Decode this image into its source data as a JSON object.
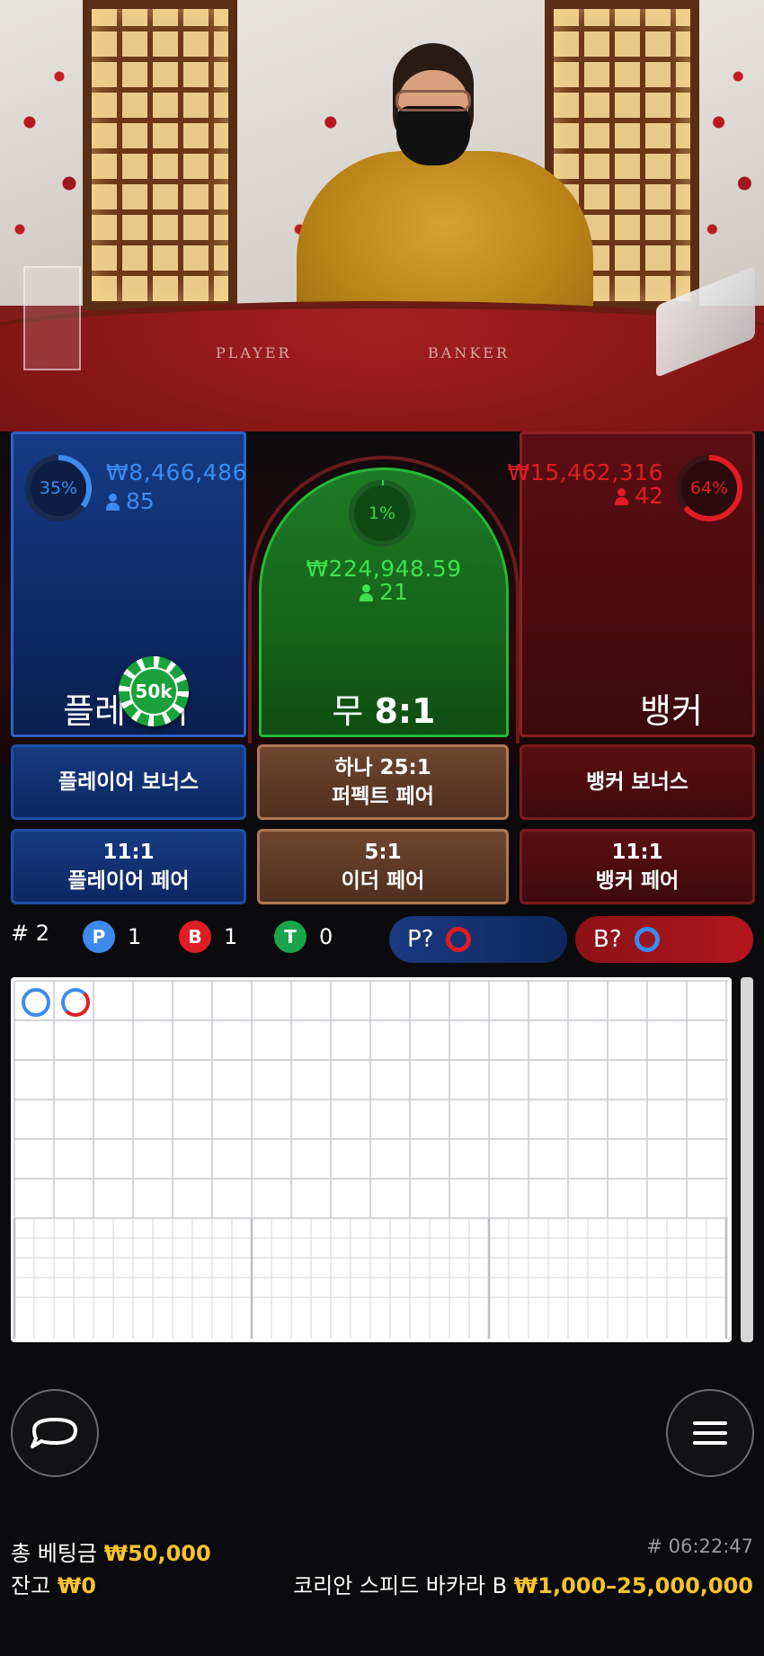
{
  "table": {
    "player_label": "PLAYER",
    "banker_label": "BANKER"
  },
  "player": {
    "percent": "35%",
    "percent_value": 0.35,
    "amount": "₩8,466,486",
    "count": "85",
    "name": "플레이어"
  },
  "tie": {
    "percent": "1%",
    "percent_value": 0.01,
    "amount": "₩224,948.59",
    "count": "21",
    "name": "무",
    "odds": "8:1"
  },
  "banker": {
    "percent": "64%",
    "percent_value": 0.64,
    "amount": "₩15,462,316",
    "count": "42",
    "name": "뱅커"
  },
  "chip": {
    "label": "50k"
  },
  "side_bets": {
    "player_bonus": "플레이어 보너스",
    "perfect_pair_line1": "하나 25:1",
    "perfect_pair_line2": "퍼펙트 페어",
    "banker_bonus": "뱅커 보너스",
    "player_pair_line1": "11:1",
    "player_pair_line2": "플레이어 페어",
    "either_pair_line1": "5:1",
    "either_pair_line2": "이더 페어",
    "banker_pair_line1": "11:1",
    "banker_pair_line2": "뱅커 페어"
  },
  "stats": {
    "round": "# 2",
    "p_letter": "P",
    "p_count": "1",
    "b_letter": "B",
    "b_count": "1",
    "t_letter": "T",
    "t_count": "0",
    "player_predict": "P?",
    "banker_predict": "B?"
  },
  "colors": {
    "player_blue": "#3d8bef",
    "banker_red": "#e11c24",
    "tie_green": "#19a64a",
    "chip_yellow": "#f6c42c"
  },
  "icons": {
    "chat": "chat-bubble-icon",
    "menu": "hamburger-menu-icon"
  },
  "footer": {
    "total_bet_label": "총 베팅금",
    "total_bet_value": "₩50,000",
    "balance_label": "잔고",
    "balance_value": "₩0",
    "time": "# 06:22:47",
    "table_name": "코리안 스피드 바카라 B",
    "limits": "₩1,000–25,000,000"
  }
}
